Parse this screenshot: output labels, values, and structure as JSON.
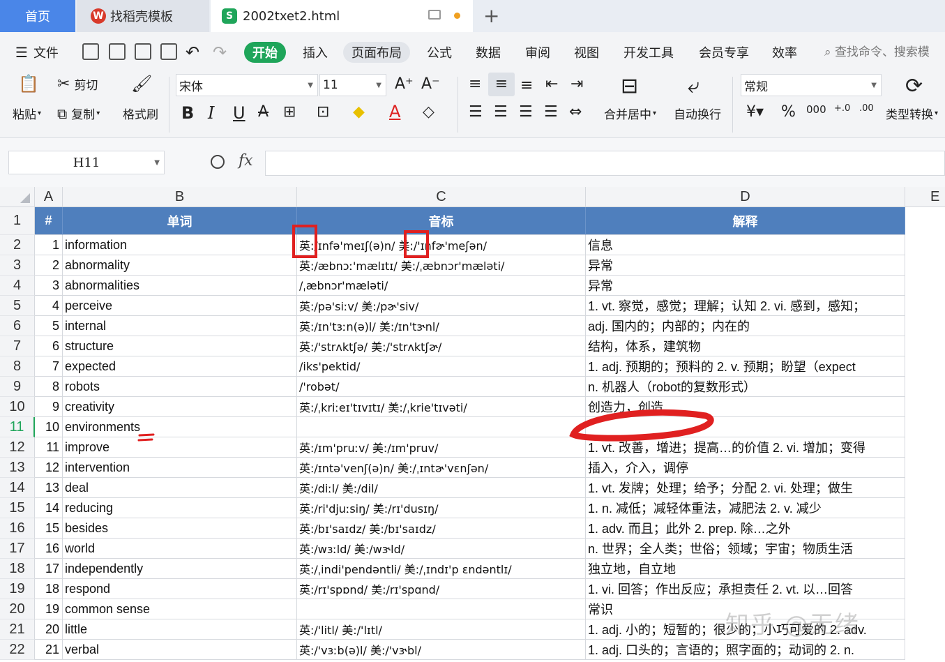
{
  "tabs": {
    "home": "首页",
    "template": "找稻壳模板",
    "file": "2002txet2.html"
  },
  "menu": {
    "file": "文件",
    "items": [
      "开始",
      "插入",
      "页面布局",
      "公式",
      "数据",
      "审阅",
      "视图",
      "开发工具",
      "会员专享",
      "效率"
    ],
    "search": "查找命令、搜索模"
  },
  "ribbon": {
    "paste": "粘贴",
    "cut": "剪切",
    "copy": "复制",
    "format_painter": "格式刷",
    "font_name": "宋体",
    "font_size": "11",
    "merge": "合并居中",
    "wrap": "自动换行",
    "number_format": "常规",
    "convert": "类型转换"
  },
  "formula": {
    "cell_ref": "H11",
    "fx": "fx",
    "value": ""
  },
  "columns": [
    "A",
    "B",
    "C",
    "D",
    "E"
  ],
  "header_row": {
    "row_number": "1",
    "num": "#",
    "word": "单词",
    "phonetic": "音标",
    "meaning": "解释"
  },
  "rows": [
    {
      "r": "2",
      "n": "1",
      "word": "information",
      "phon": "英:/ɪnfə'meɪʃ(ə)n/ 美:/'ɪnfɚ'meʃən/",
      "mean": "信息"
    },
    {
      "r": "3",
      "n": "2",
      "word": "abnormality",
      "phon": "英:/æbnɔː'mælɪtɪ/ 美:/ˌæbnɔr'mæləti/",
      "mean": "异常"
    },
    {
      "r": "4",
      "n": "3",
      "word": "abnormalities",
      "phon": "/ˌæbnɔr'mæləti/",
      "mean": "异常"
    },
    {
      "r": "5",
      "n": "4",
      "word": "perceive",
      "phon": "英:/pə'siːv/ 美:/pɚ'siv/",
      "mean": "1. vt. 察觉，感觉；理解；认知 2. vi. 感到，感知；"
    },
    {
      "r": "6",
      "n": "5",
      "word": "internal",
      "phon": "英:/ɪn'tɜːn(ə)l/ 美:/ɪn'tɝnl/",
      "mean": "adj. 国内的；内部的；内在的"
    },
    {
      "r": "7",
      "n": "6",
      "word": "structure",
      "phon": "英:/'strʌktʃə/ 美:/'strʌktʃɚ/",
      "mean": "结构，体系，建筑物"
    },
    {
      "r": "8",
      "n": "7",
      "word": "expected",
      "phon": "/iks'pektid/",
      "mean": "1. adj. 预期的；预料的 2. v. 预期；盼望（expect"
    },
    {
      "r": "9",
      "n": "8",
      "word": "robots",
      "phon": "/'robət/",
      "mean": "n. 机器人（robot的复数形式）"
    },
    {
      "r": "10",
      "n": "9",
      "word": "creativity",
      "phon": "英:/ˌkriːeɪ'tɪvɪtɪ/ 美:/ˌkrie'tɪvəti/",
      "mean": "创造力，创造"
    },
    {
      "r": "11",
      "n": "10",
      "word": "environments",
      "phon": "",
      "mean": ""
    },
    {
      "r": "12",
      "n": "11",
      "word": "improve",
      "phon": "英:/ɪm'pruːv/ 美:/ɪm'pruv/",
      "mean": "1. vt. 改善，增进；提高…的价值 2. vi. 增加；变得"
    },
    {
      "r": "13",
      "n": "12",
      "word": "intervention",
      "phon": "英:/ɪntə'venʃ(ə)n/ 美:/ˌɪntɚ'vɛnʃən/",
      "mean": "插入，介入，调停"
    },
    {
      "r": "14",
      "n": "13",
      "word": "deal",
      "phon": "英:/diːl/ 美:/dil/",
      "mean": "1. vt. 发牌；处理；给予；分配 2. vi. 处理；做生"
    },
    {
      "r": "15",
      "n": "14",
      "word": "reducing",
      "phon": "英:/ri'djuːsiŋ/ 美:/rɪ'dusɪŋ/",
      "mean": "1. n. 减低；减轻体重法，减肥法 2. v. 减少"
    },
    {
      "r": "16",
      "n": "15",
      "word": "besides",
      "phon": "英:/bɪ'saɪdz/ 美:/bɪ'saɪdz/",
      "mean": "1. adv. 而且；此外 2. prep. 除…之外"
    },
    {
      "r": "17",
      "n": "16",
      "word": "world",
      "phon": "英:/wɜːld/ 美:/wɝld/",
      "mean": "n. 世界；全人类；世俗；领域；宇宙；物质生活"
    },
    {
      "r": "18",
      "n": "17",
      "word": "independently",
      "phon": "英:/ˌindi'pendəntli/ 美:/ˌɪndɪ'p ɛndəntlɪ/",
      "mean": "独立地，自立地"
    },
    {
      "r": "19",
      "n": "18",
      "word": "respond",
      "phon": "英:/rɪ'spɒnd/ 美:/rɪ'spɑnd/",
      "mean": "1. vi. 回答；作出反应；承担责任 2. vt. 以…回答"
    },
    {
      "r": "20",
      "n": "19",
      "word": "common sense",
      "phon": "",
      "mean": "常识"
    },
    {
      "r": "21",
      "n": "20",
      "word": "little",
      "phon": "英:/'litl/ 美:/'lɪtl/",
      "mean": "1. adj. 小的；短暂的；很少的；小巧可爱的 2. adv."
    },
    {
      "r": "22",
      "n": "21",
      "word": "verbal",
      "phon": "英:/'vɜːb(ə)l/ 美:/'vɝbl/",
      "mean": "1. adj. 口头的；言语的；照字面的；动词的 2. n."
    }
  ],
  "watermark": "知乎 @无绪",
  "colors": {
    "accent_green": "#1fa55a",
    "header_blue": "#4f7fbd",
    "home_tab_blue": "#4a86e8",
    "annotation_red": "#e02020"
  }
}
